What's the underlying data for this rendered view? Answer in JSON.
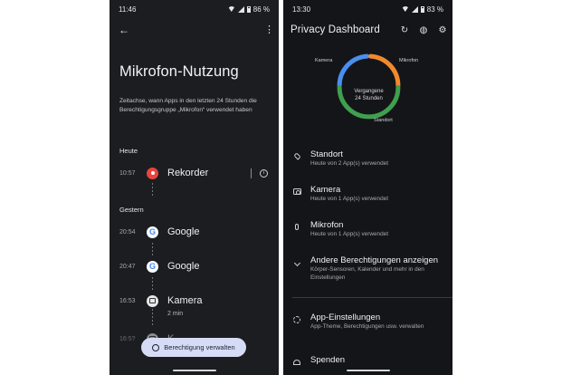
{
  "left": {
    "status": {
      "time": "11:46",
      "battery": "86 %"
    },
    "title": "Mikrofon-Nutzung",
    "description": "Zeitachse, wann Apps in den letzten 24 Stunden die Berechtigungsgruppe „Mikrofon“ verwendet haben",
    "sections": [
      {
        "label": "Heute"
      },
      {
        "label": "Gestern"
      }
    ],
    "entries": [
      {
        "time": "10:57",
        "app": "Rekorder",
        "sub": "",
        "icon": "recorder-icon"
      },
      {
        "time": "20:54",
        "app": "Google",
        "sub": "",
        "icon": "google-icon"
      },
      {
        "time": "20:47",
        "app": "Google",
        "sub": "",
        "icon": "google-icon"
      },
      {
        "time": "16:53",
        "app": "Kamera",
        "sub": "2 min",
        "icon": "camera-icon"
      },
      {
        "time": "16:5?",
        "app": "K...",
        "sub": "",
        "icon": "camera-icon"
      }
    ],
    "button_label": "Berechtigung verwalten",
    "google_glyph": "G",
    "info_glyph": "i"
  },
  "right": {
    "status": {
      "time": "13:30",
      "battery": "83 %"
    },
    "title": "Privacy Dashboard",
    "chart": {
      "labels": {
        "camera": "Kamera",
        "mic": "Mikrofon",
        "location": "Standort"
      },
      "center_text_1": "Vergangene",
      "center_text_2": "24 Stunden",
      "colors": {
        "camera": "#4a8ff0",
        "mic": "#f18a2e",
        "location": "#3f9f4e"
      }
    },
    "items": [
      {
        "title": "Standort",
        "sub": "Heute von 2 App(s) verwendet",
        "icon": "location-icon"
      },
      {
        "title": "Kamera",
        "sub": "Heute von 1 App(s) verwendet",
        "icon": "camera-icon"
      },
      {
        "title": "Mikrofon",
        "sub": "Heute von 1 App(s) verwendet",
        "icon": "mic-icon"
      },
      {
        "title": "Andere Berechtigungen anzeigen",
        "sub": "Körper-Sensoren, Kalender und mehr in den Einstellungen",
        "icon": "chevron-down-icon"
      },
      {
        "title": "App-Einstellungen",
        "sub": "App-Theme, Berechtigungen usw. verwalten",
        "icon": "gear-icon"
      },
      {
        "title": "Spenden",
        "sub": "",
        "icon": "heart-icon"
      }
    ]
  }
}
